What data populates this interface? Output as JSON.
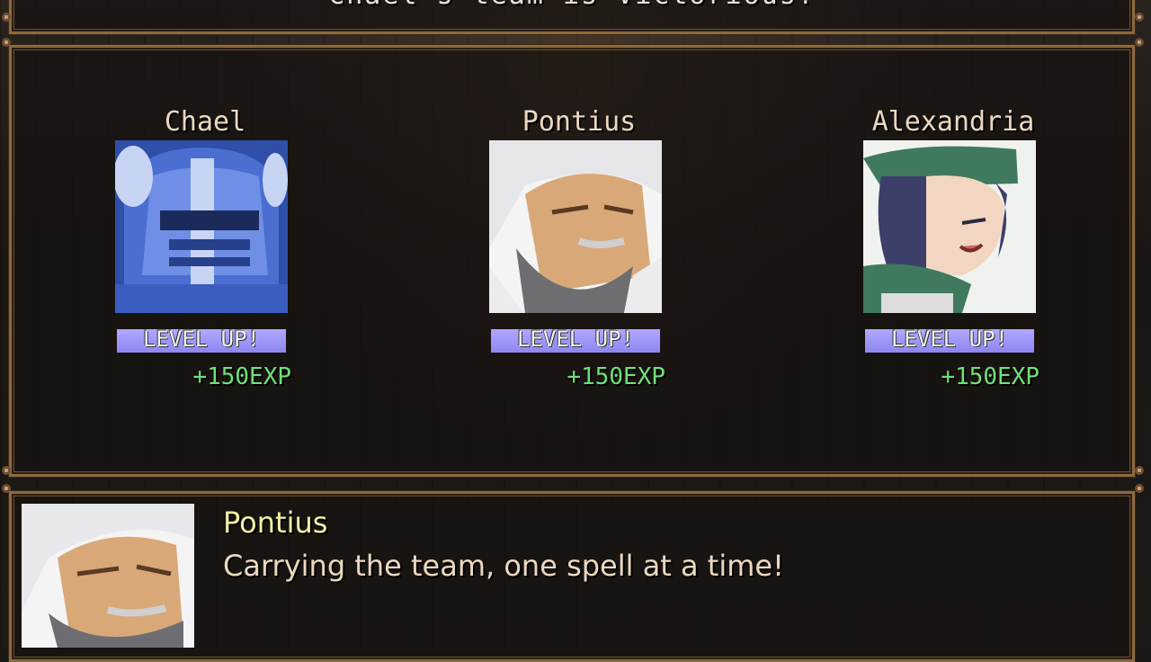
{
  "banner": {
    "text": "Chael's team is Victorious!"
  },
  "party": [
    {
      "name": "Chael",
      "level_label": "LEVEL UP!",
      "exp": "+150EXP"
    },
    {
      "name": "Pontius",
      "level_label": "LEVEL UP!",
      "exp": "+150EXP"
    },
    {
      "name": "Alexandria",
      "level_label": "LEVEL UP!",
      "exp": "+150EXP"
    }
  ],
  "message": {
    "speaker": "Pontius",
    "text": "Carrying the team, one spell at a time!"
  },
  "colors": {
    "frame": "#8b6a3e",
    "level_bar": "#9f98f6",
    "exp_text": "#6fe07a",
    "speaker_name": "#f3efa6"
  }
}
